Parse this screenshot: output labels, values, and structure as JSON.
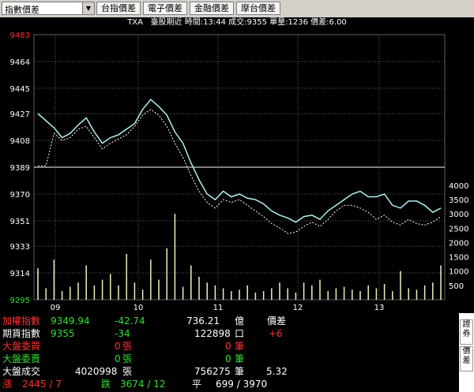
{
  "toolbar": {
    "select_value": "指數價差",
    "buttons": [
      "台指價差",
      "電子價差",
      "金融價差",
      "摩台價差"
    ]
  },
  "infobar": {
    "symbol": "TXA",
    "contract": "臺股期近",
    "time_label": "時間:13:44",
    "trade_label": "成交:9355",
    "volume_label": "單量:1236",
    "spread_label": "價差:6.00"
  },
  "chart_data": {
    "type": "line",
    "x_ticks": [
      "09",
      "10",
      "11",
      "12",
      "13"
    ],
    "y_ticks": [
      "9483",
      "9464",
      "9445",
      "9427",
      "9408",
      "9389",
      "9370",
      "9351",
      "9333",
      "9314",
      "9295"
    ],
    "ylim": [
      9295,
      9483
    ],
    "vol_ticks": [
      "4000",
      "3500",
      "3000",
      "2500",
      "2000",
      "1500",
      "1000",
      "500"
    ],
    "vol_lim": [
      0,
      4300
    ],
    "series": [
      {
        "values": [
          9427,
          9422,
          9417,
          9410,
          9413,
          9419,
          9424,
          9414,
          9406,
          9410,
          9412,
          9416,
          9420,
          9430,
          9437,
          9432,
          9426,
          9414,
          9406,
          9392,
          9380,
          9370,
          9366,
          9372,
          9368,
          9370,
          9367,
          9366,
          9363,
          9358,
          9355,
          9353,
          9350,
          9354,
          9355,
          9352,
          9358,
          9362,
          9366,
          9370,
          9372,
          9368,
          9368,
          9370,
          9362,
          9360,
          9365,
          9365,
          9362,
          9357,
          9360
        ]
      },
      {
        "values": [
          9390,
          9390,
          9413,
          9408,
          9410,
          9416,
          9418,
          9410,
          9402,
          9406,
          9409,
          9412,
          9418,
          9426,
          9430,
          9426,
          9418,
          9406,
          9396,
          9383,
          9372,
          9364,
          9360,
          9366,
          9364,
          9366,
          9362,
          9358,
          9354,
          9349,
          9346,
          9342,
          9343,
          9347,
          9350,
          9347,
          9352,
          9358,
          9362,
          9362,
          9360,
          9357,
          9352,
          9355,
          9350,
          9348,
          9352,
          9349,
          9348,
          9350,
          9354
        ]
      }
    ],
    "volume": [
      1100,
      400,
      1400,
      300,
      450,
      600,
      1200,
      500,
      700,
      900,
      500,
      1600,
      600,
      350,
      1400,
      700,
      1800,
      3000,
      450,
      1200,
      800,
      600,
      500,
      400,
      300,
      350,
      500,
      250,
      300,
      400,
      600,
      400,
      250,
      600,
      500,
      700,
      300,
      400,
      450,
      350,
      300,
      500,
      400,
      550,
      300,
      1000,
      400,
      350,
      500,
      600,
      1200
    ]
  },
  "quote": {
    "row1": {
      "label": "加權指數",
      "price": "9349.94",
      "change": "-42.74",
      "amount": "736.21",
      "unit": "億",
      "spread_label": "價差"
    },
    "row2": {
      "label": "期貨指數",
      "price": "9355",
      "change": "-34",
      "qty": "122898",
      "unit": "口",
      "spread": "+6"
    },
    "row3": {
      "label": "大盤委買",
      "value": "0",
      "unit": "張",
      "value2": "0",
      "unit2": "筆"
    },
    "row4": {
      "label": "大盤委賣",
      "value": "0",
      "unit": "張",
      "value2": "0",
      "unit2": "筆"
    },
    "row5": {
      "label": "大盤成交",
      "value": "4020998",
      "unit": "張",
      "value2": "756275",
      "unit2": "筆",
      "ratio": "5.32"
    },
    "row6": {
      "up_label": "漲",
      "up": "2445 / 7",
      "down_label": "跌",
      "down": "3674 / 12",
      "flat_label": "平",
      "flat": "699 / 3970"
    }
  },
  "sidepanel": {
    "tab1": "證券",
    "tab2": "價差"
  },
  "colors": {
    "red": "#ff3030",
    "green": "#30e030",
    "white": "#ffffff",
    "cyan": "#b0f0f0",
    "grid": "#606060"
  }
}
